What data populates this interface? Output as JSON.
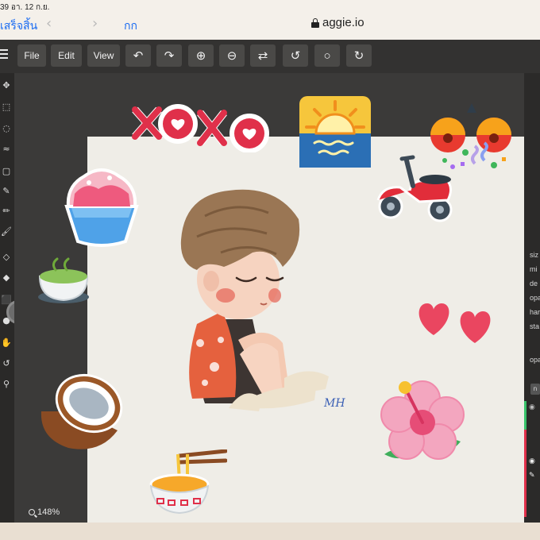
{
  "status_bar": {
    "clock": "39 อา. 12 ก.ย."
  },
  "browser": {
    "done_label": "เสร็จสิ้น",
    "text_size_label": "กก",
    "url": "aggie.io"
  },
  "toolbar": {
    "menu_file": "File",
    "menu_edit": "Edit",
    "menu_view": "View",
    "icons": {
      "undo": "↶",
      "redo": "↷",
      "zoom_in": "⊕",
      "zoom_out": "⊖",
      "flip": "⇄",
      "rotate_left": "↺",
      "reset": "○",
      "rotate_right": "↻"
    }
  },
  "left_tools": [
    "✥",
    "⬚",
    "◌",
    "≈",
    "▢",
    "✎",
    "✏",
    "🖌",
    "◇",
    "◆",
    "⬛",
    "●",
    "✋",
    "↺",
    "⚲"
  ],
  "right_panel": {
    "labels": [
      "siz",
      "mi",
      "de",
      "opa",
      "har",
      "sta",
      "opa"
    ],
    "layer_button": "n"
  },
  "canvas": {
    "zoom": "148%",
    "signature": "MH"
  },
  "stickers": [
    "xoxo",
    "sunrise",
    "party-popper",
    "shaved-ice",
    "scooter",
    "matcha",
    "hearts",
    "coconut",
    "hibiscus",
    "ramen"
  ],
  "colors": {
    "accent": "#1b6cf2",
    "toolbar": "#333231",
    "canvas": "#efede7",
    "workspace": "#3b3a39",
    "sticker_red": "#e0304a"
  }
}
